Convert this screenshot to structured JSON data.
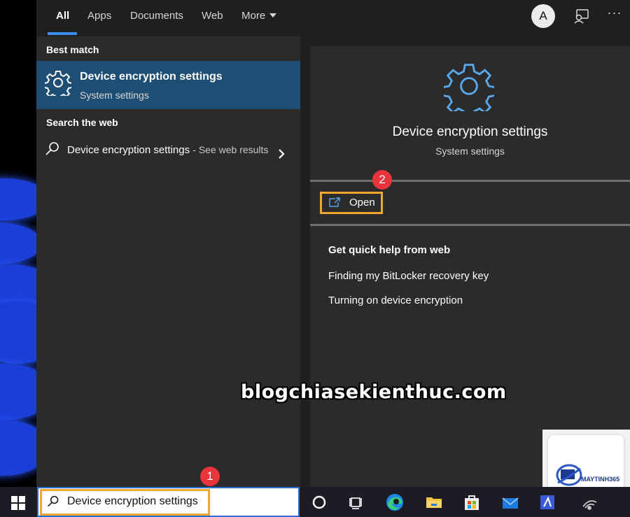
{
  "tabs": [
    {
      "label": "All",
      "active": true
    },
    {
      "label": "Apps"
    },
    {
      "label": "Documents"
    },
    {
      "label": "Web"
    },
    {
      "label": "More"
    }
  ],
  "header": {
    "avatar_initial": "A",
    "feedback_icon": "feedback-icon",
    "options_icon": "more-options-icon",
    "options_label": "···"
  },
  "best_match": {
    "section_title": "Best match",
    "title": "Device encryption settings",
    "subtitle": "System settings",
    "icon": "gear-icon"
  },
  "web_search": {
    "section_title": "Search the web",
    "query": "Device encryption settings",
    "suffix": "- See web results",
    "icon": "search-icon"
  },
  "detail": {
    "title": "Device encryption settings",
    "subtitle": "System settings",
    "open_label": "Open",
    "help_title": "Get quick help from web",
    "help_links": [
      "Finding my BitLocker recovery key",
      "Turning on device encryption"
    ]
  },
  "annotations": {
    "step1": "1",
    "step2": "2",
    "highlight_color": "#f0a830",
    "badge_color": "#e8343a"
  },
  "watermark": "blogchiasekienthuc.com",
  "logo": {
    "text": "MAYTINH365"
  },
  "taskbar": {
    "search_value": "Device encryption settings",
    "icons": [
      "windows-start-icon",
      "cortana-icon",
      "task-view-icon",
      "edge-icon",
      "file-explorer-icon",
      "store-icon",
      "mail-icon",
      "app-icon",
      "network-icon"
    ]
  },
  "colors": {
    "accent": "#3c8ef2",
    "selected": "#1f4e74",
    "panel": "#2b2b2b",
    "topbar": "#1f1f1f",
    "taskbar": "#1c1c24"
  }
}
